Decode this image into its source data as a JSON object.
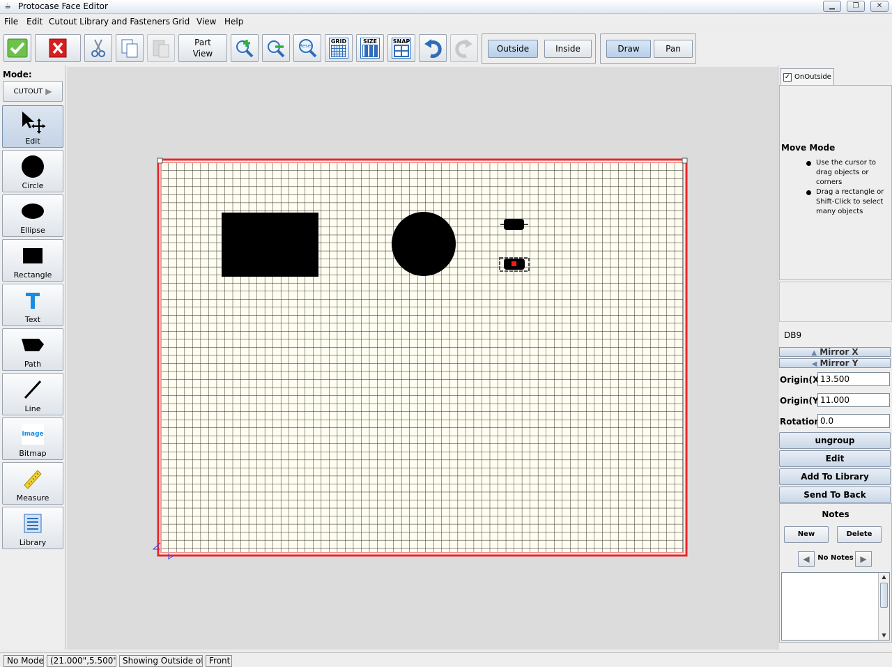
{
  "window": {
    "title": "Protocase Face Editor"
  },
  "menu": {
    "items": [
      "File",
      "Edit",
      "Cutout Library and Fasteners",
      "Grid",
      "View",
      "Help"
    ]
  },
  "toolbar": {
    "part_view_line1": "Part",
    "part_view_line2": "View",
    "grid_icon": "GRID",
    "size_icon": "SIZE",
    "snap_icon": "SNAP",
    "reset_icon": "Reset",
    "side_buttons": [
      "Outside",
      "Inside"
    ],
    "tool_buttons": [
      "Draw",
      "Pan"
    ]
  },
  "left_panel": {
    "mode_label": "Mode:",
    "mode_value": "CUTOUT",
    "tools": [
      "Edit",
      "Circle",
      "Ellipse",
      "Rectangle",
      "Text",
      "Path",
      "Line",
      "Bitmap",
      "Measure",
      "Library"
    ],
    "bitmap_icon_text": "Image"
  },
  "right_panel": {
    "tab_label": "OnOutside",
    "help_title": "Move Mode",
    "help_items": [
      "Use the cursor to drag objects or corners",
      "Drag a rectangle or Shift-Click to select many objects"
    ],
    "part_name": "DB9",
    "mirror_x": "Mirror X",
    "mirror_y": "Mirror Y",
    "origin_x_label": "Origin(X)",
    "origin_x_value": "13.500",
    "origin_y_label": "Origin(Y)",
    "origin_y_value": "11.000",
    "rotation_label": "Rotation",
    "rotation_value": "0.0",
    "buttons": [
      "ungroup",
      "Edit",
      "Add To Library",
      "Send To Back"
    ],
    "notes": {
      "title": "Notes",
      "new_label": "New",
      "delete_label": "Delete",
      "status": "No Notes"
    }
  },
  "status_bar": {
    "mode": "No Mode",
    "coords": "(21.000\",5.500\")",
    "showing": "Showing Outside of",
    "face": "Front"
  },
  "colors": {
    "border_red": "#e8262a",
    "canvas_fill": "#fffdf0",
    "grid_line": "#1a1a1a",
    "cutout_fill": "#000000",
    "accent_blue": "#2f6db8"
  }
}
